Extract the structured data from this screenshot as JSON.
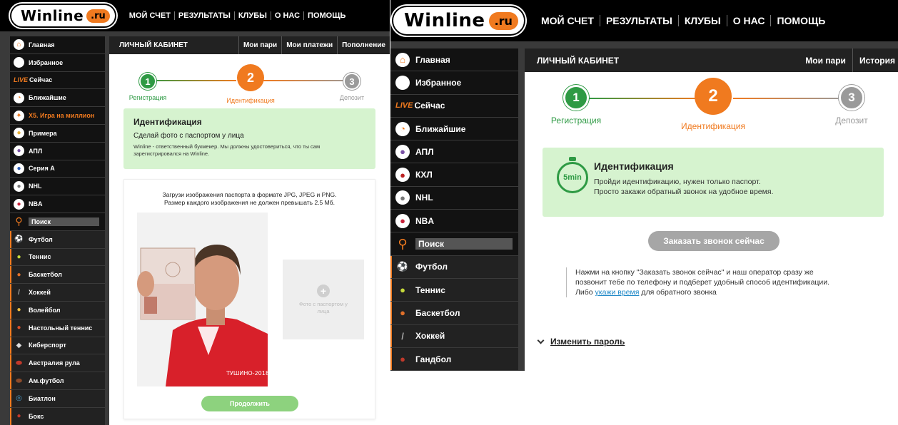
{
  "logo": {
    "word": "Winline",
    "ru": ".ru"
  },
  "nav": [
    "МОЙ СЧЕТ",
    "РЕЗУЛЬТАТЫ",
    "КЛУБЫ",
    "О НАС",
    "ПОМОЩЬ"
  ],
  "left": {
    "sidebar": [
      {
        "label": "Главная",
        "icon": "home-icon"
      },
      {
        "label": "Избранное",
        "icon": "star-icon"
      },
      {
        "label": "Сейчас",
        "icon": "live-icon",
        "prefix": "LIVE"
      },
      {
        "label": "Ближайшие",
        "icon": "clock-icon"
      },
      {
        "label": "Х5. Игра на миллион",
        "icon": "promo-icon",
        "highlight": true
      },
      {
        "label": "Примера",
        "icon": "laliga-icon"
      },
      {
        "label": "АПЛ",
        "icon": "epl-icon"
      },
      {
        "label": "Серия А",
        "icon": "seriea-icon"
      },
      {
        "label": "NHL",
        "icon": "nhl-icon"
      },
      {
        "label": "NBA",
        "icon": "nba-icon"
      },
      {
        "label": "Поиск",
        "icon": "search-icon",
        "search": true
      },
      {
        "label": "Футбол",
        "icon": "football-icon",
        "sport": true
      },
      {
        "label": "Теннис",
        "icon": "tennis-icon",
        "sport": true
      },
      {
        "label": "Баскетбол",
        "icon": "basketball-icon",
        "sport": true
      },
      {
        "label": "Хоккей",
        "icon": "hockey-icon",
        "sport": true
      },
      {
        "label": "Волейбол",
        "icon": "volleyball-icon",
        "sport": true
      },
      {
        "label": "Настольный теннис",
        "icon": "table-tennis-icon",
        "sport": true
      },
      {
        "label": "Киберспорт",
        "icon": "esports-icon",
        "sport": true
      },
      {
        "label": "Австралия рула",
        "icon": "aussie-rules-icon",
        "sport": true
      },
      {
        "label": "Ам.футбол",
        "icon": "american-football-icon",
        "sport": true
      },
      {
        "label": "Биатлон",
        "icon": "biathlon-icon",
        "sport": true
      },
      {
        "label": "Бокс",
        "icon": "boxing-icon",
        "sport": true
      }
    ],
    "header": "ЛИЧНЫЙ КАБИНЕТ",
    "tabs": [
      "Мои пари",
      "Мои платежи",
      "Пополнение"
    ],
    "steps": [
      "Регистрация",
      "Идентификация",
      "Депозит"
    ],
    "info_title": "Идентификация",
    "info_text": "Сделай фото с паспортом у лица",
    "info_small": "Winline - ответственный букмекер. Мы должны удостовериться, что ты сам зарегистрировался на Winline.",
    "upload_line1": "Загрузи изображения паспорта в формате JPG, JPEG и PNG.",
    "upload_line2": "Размер каждого изображения не должен превышать 2.5 Мб.",
    "photo_caption": "ТУШИНО-2018",
    "upload_slot_label": "Фото с паспортом у лица",
    "continue_label": "Продолжить"
  },
  "right": {
    "sidebar": [
      {
        "label": "Главная",
        "icon": "home-icon"
      },
      {
        "label": "Избранное",
        "icon": "star-icon"
      },
      {
        "label": "Сейчас",
        "icon": "live-icon",
        "prefix": "LIVE"
      },
      {
        "label": "Ближайшие",
        "icon": "clock-icon"
      },
      {
        "label": "АПЛ",
        "icon": "epl-icon"
      },
      {
        "label": "КХЛ",
        "icon": "khl-icon"
      },
      {
        "label": "NHL",
        "icon": "nhl-icon"
      },
      {
        "label": "NBA",
        "icon": "nba-icon"
      },
      {
        "label": "Поиск",
        "icon": "search-icon",
        "search": true
      },
      {
        "label": "Футбол",
        "icon": "football-icon",
        "sport": true
      },
      {
        "label": "Теннис",
        "icon": "tennis-icon",
        "sport": true
      },
      {
        "label": "Баскетбол",
        "icon": "basketball-icon",
        "sport": true
      },
      {
        "label": "Хоккей",
        "icon": "hockey-icon",
        "sport": true
      },
      {
        "label": "Гандбол",
        "icon": "handball-icon",
        "sport": true
      }
    ],
    "header": "ЛИЧНЫЙ КАБИНЕТ",
    "tabs": [
      "Мои пари",
      "История"
    ],
    "steps": [
      "Регистрация",
      "Идентификация",
      "Депозит"
    ],
    "timer_label": "5min",
    "info_title": "Идентификация",
    "info_line1": "Пройди идентификацию, нужен только паспорт.",
    "info_line2": "Просто закажи обратный звонок на удобное время.",
    "call_button": "Заказать звонок сейчас",
    "note_line1": "Нажми на кнопку \"Заказать звонок сейчас\" и наш оператор сразу же",
    "note_line2": "позвонит тебе по телефону и подберет удобный способ идентификации.",
    "note_line3_pre": "Либо",
    "note_link": "укажи время",
    "note_line3_post": "для обратного звонка",
    "change_password": "Изменить пароль"
  },
  "colors": {
    "green": "#2e9a44",
    "orange": "#f07a1f",
    "grey": "#9a9a9a",
    "greenBox": "#d6f3cf"
  }
}
